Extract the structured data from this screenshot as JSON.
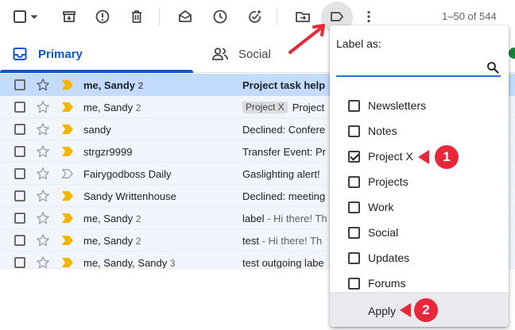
{
  "toolbar": {
    "page_range": "1–50 of 544",
    "icons": [
      "select-all-checkbox",
      "select-dropdown-caret",
      "archive-icon",
      "report-spam-icon",
      "delete-icon",
      "mark-unread-icon",
      "snooze-icon",
      "add-task-icon",
      "move-to-icon",
      "label-icon",
      "more-icon"
    ]
  },
  "tabs": {
    "primary": "Primary",
    "social": "Social"
  },
  "emails": [
    {
      "sender": "me, Sandy",
      "count": "2",
      "tag": "",
      "subject": "Project task help",
      "snippet": "",
      "important": true,
      "selected": true,
      "bold": true
    },
    {
      "sender": "me, Sandy",
      "count": "2",
      "tag": "Project X",
      "subject": "Project",
      "snippet": "",
      "important": true,
      "selected": false,
      "bold": false
    },
    {
      "sender": "sandy",
      "count": "",
      "tag": "",
      "subject": "Declined: Confere",
      "snippet": "",
      "important": true,
      "selected": false,
      "bold": false
    },
    {
      "sender": "strgzr9999",
      "count": "",
      "tag": "",
      "subject": "Transfer Event: Pr",
      "snippet": "",
      "important": true,
      "selected": false,
      "bold": false
    },
    {
      "sender": "Fairygodboss Daily",
      "count": "",
      "tag": "",
      "subject": "Gaslighting alert!",
      "snippet": "",
      "important": false,
      "selected": false,
      "bold": false
    },
    {
      "sender": "Sandy Writtenhouse",
      "count": "",
      "tag": "",
      "subject": "Declined: meeting",
      "snippet": "",
      "important": true,
      "selected": false,
      "bold": false
    },
    {
      "sender": "me, Sandy",
      "count": "2",
      "tag": "",
      "subject": "label",
      "snippet": " - Hi there! Th",
      "important": true,
      "selected": false,
      "bold": false
    },
    {
      "sender": "me, Sandy",
      "count": "2",
      "tag": "",
      "subject": "test",
      "snippet": " - Hi there! Th",
      "important": true,
      "selected": false,
      "bold": false
    },
    {
      "sender": "me, Sandy, Sandy",
      "count": "3",
      "tag": "",
      "subject": "test outgoing labe",
      "snippet": "",
      "important": true,
      "selected": false,
      "bold": false
    }
  ],
  "label_menu": {
    "title": "Label as:",
    "search_value": "",
    "labels": [
      {
        "name": "Newsletters",
        "checked": false
      },
      {
        "name": "Notes",
        "checked": false
      },
      {
        "name": "Project X",
        "checked": true
      },
      {
        "name": "Projects",
        "checked": false
      },
      {
        "name": "Work",
        "checked": false
      },
      {
        "name": "Social",
        "checked": false
      },
      {
        "name": "Updates",
        "checked": false
      },
      {
        "name": "Forums",
        "checked": false
      }
    ],
    "apply_label": "Apply"
  },
  "annotations": {
    "badge_1": "1",
    "badge_2": "2"
  },
  "colors": {
    "accent": "#0b57d0",
    "selected_row": "#c2dbff",
    "important_marker": "#f2b600",
    "annotation_red": "#e8283a",
    "search_underline": "#1a73e8"
  }
}
